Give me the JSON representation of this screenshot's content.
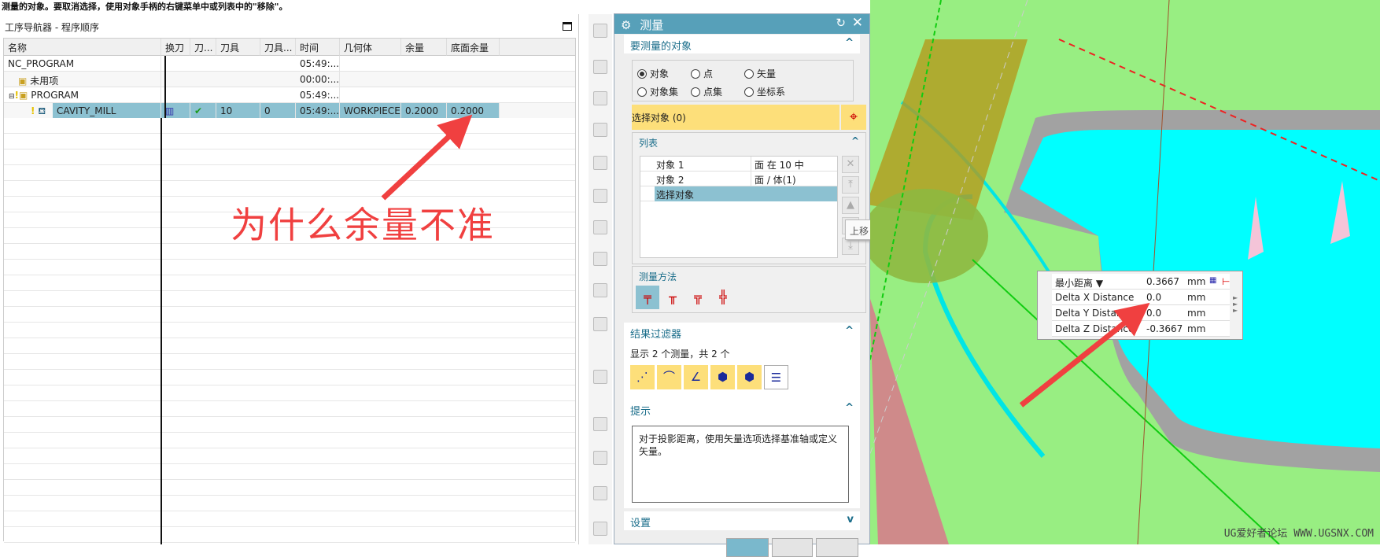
{
  "hint": "测量的对象。要取消选择，使用对象手柄的右键菜单中或列表中的\"移除\"。",
  "navigator": {
    "title": "工序导航器 - 程序顺序",
    "columns": [
      "名称",
      "换刀",
      "刀...",
      "刀具",
      "刀具...",
      "时间",
      "几何体",
      "余量",
      "底面余量"
    ],
    "rows": [
      {
        "name": "NC_PROGRAM",
        "time": "05:49:..."
      },
      {
        "name": "未用项",
        "time": "00:00:..."
      },
      {
        "name": "PROGRAM",
        "time": "05:49:..."
      },
      {
        "name": "CAVITY_MILL",
        "tool": "10",
        "tool_no": "0",
        "time": "05:49:...",
        "geometry": "WORKPIECE",
        "stock": "0.2000",
        "floor_stock": "0.2000"
      }
    ]
  },
  "annotation": "为什么余量不准",
  "dialog": {
    "title": "测量",
    "sec_objects": "要测量的对象",
    "radios": [
      "对象",
      "点",
      "矢量",
      "对象集",
      "点集",
      "坐标系"
    ],
    "selected_radio": "对象",
    "select_label": "选择对象 (0)",
    "list_title": "列表",
    "list": [
      {
        "name": "对象 1",
        "value": "面 在 10 中"
      },
      {
        "name": "对象 2",
        "value": "面 / 体(1)"
      },
      {
        "name": "选择对象",
        "value": ""
      }
    ],
    "tooltip": "上移",
    "method_title": "测量方法",
    "filter_title": "结果过滤器",
    "filter_text": "显示 2 个测量，共 2 个",
    "tip_title": "提示",
    "tip_text": "对于投影距离，使用矢量选项选择基准轴或定义矢量。",
    "settings_title": "设置"
  },
  "measurement": {
    "rows": [
      {
        "label": "最小距离 ▼",
        "value": "0.3667",
        "unit": "mm"
      },
      {
        "label": "Delta X Distance",
        "value": "0.0",
        "unit": "mm"
      },
      {
        "label": "Delta Y Distance",
        "value": "0.0",
        "unit": "mm"
      },
      {
        "label": "Delta Z Distance",
        "value": "-0.3667",
        "unit": "mm"
      }
    ]
  },
  "watermark": "UG爱好者论坛 WWW.UGSNX.COM",
  "colors": {
    "accent": "#57a0b9",
    "selection": "#8cc1d1",
    "highlight": "#fddf7a",
    "annotation": "#f04040"
  }
}
